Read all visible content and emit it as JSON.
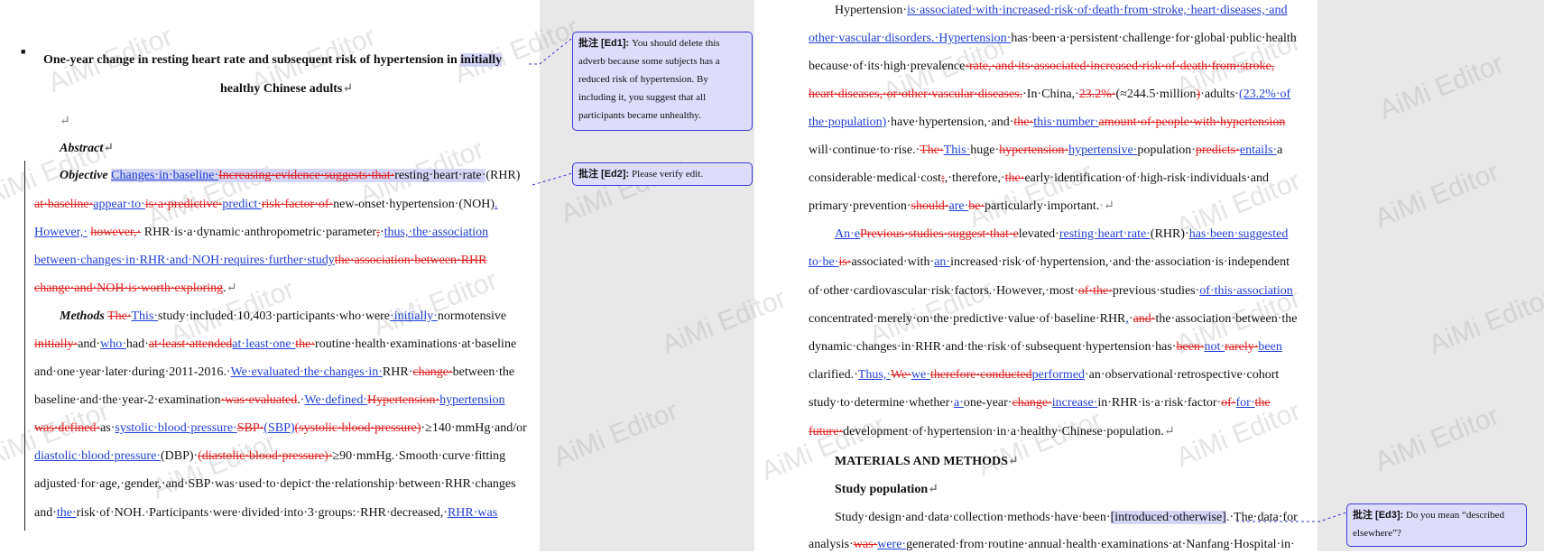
{
  "watermark": "AiMi Editor",
  "left_page": {
    "title_line1": "One-year change in resting heart rate and subsequent risk of hypertension in ",
    "title_hl": "initially",
    "title_line2": "healthy Chinese adults",
    "abstract_heading": "Abstract",
    "objective_label": "Objective",
    "methods_label": "Methods"
  },
  "right_page": {
    "heading_methods": "MATERIALS AND METHODS",
    "heading_population": "Study population"
  },
  "comments": [
    {
      "label": "批注 [Ed1]:",
      "text": "You should delete this adverb because some subjects has a reduced risk of hypertension.   By including it, you suggest that all participants became unhealthy."
    },
    {
      "label": "批注 [Ed2]:",
      "text": "Please verify edit."
    },
    {
      "label": "批注 [Ed3]:",
      "text": "Do you mean “described elsewhere”?"
    }
  ]
}
